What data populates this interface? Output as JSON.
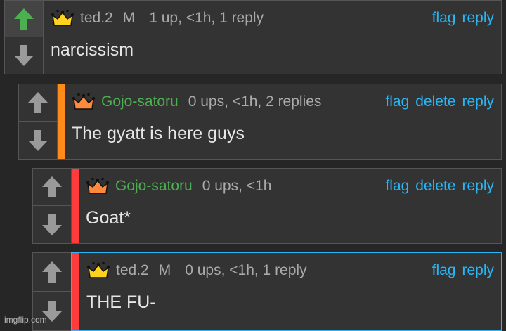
{
  "colors": {
    "background": "#262626",
    "panel": "#333333",
    "link": "#29b6f6",
    "upvote_active": "#4caf50",
    "arrow_idle": "#9a9a9a",
    "orange_bar": "#ff8c1a",
    "red_bar": "#ff3b3b",
    "highlight_border": "#29b6f6"
  },
  "comments": [
    {
      "username": "ted.2",
      "username_color": "#aaaaaa",
      "badge": "M",
      "crown": "crown-yellow-icon",
      "stats": "1 up, <1h, 1 reply",
      "actions": [
        "flag",
        "reply"
      ],
      "text": "narcissism",
      "upvoted": true
    },
    {
      "username": "Gojo-satoru",
      "username_color": "#4caf50",
      "badge": "",
      "crown": "crown-orange-icon",
      "stats": "0 ups, <1h, 2 replies",
      "actions": [
        "flag",
        "delete",
        "reply"
      ],
      "text": "The gyatt is here guys",
      "upvoted": false
    },
    {
      "username": "Gojo-satoru",
      "username_color": "#4caf50",
      "badge": "",
      "crown": "crown-orange-icon",
      "stats": "0 ups, <1h",
      "actions": [
        "flag",
        "delete",
        "reply"
      ],
      "text": "Goat*",
      "upvoted": false
    },
    {
      "username": "ted.2",
      "username_color": "#aaaaaa",
      "badge": "M",
      "crown": "crown-yellow-icon",
      "stats": "0 ups, <1h, 1 reply",
      "actions": [
        "flag",
        "reply"
      ],
      "text": "THE FU-",
      "upvoted": false
    }
  ],
  "watermark": "imgflip.com"
}
